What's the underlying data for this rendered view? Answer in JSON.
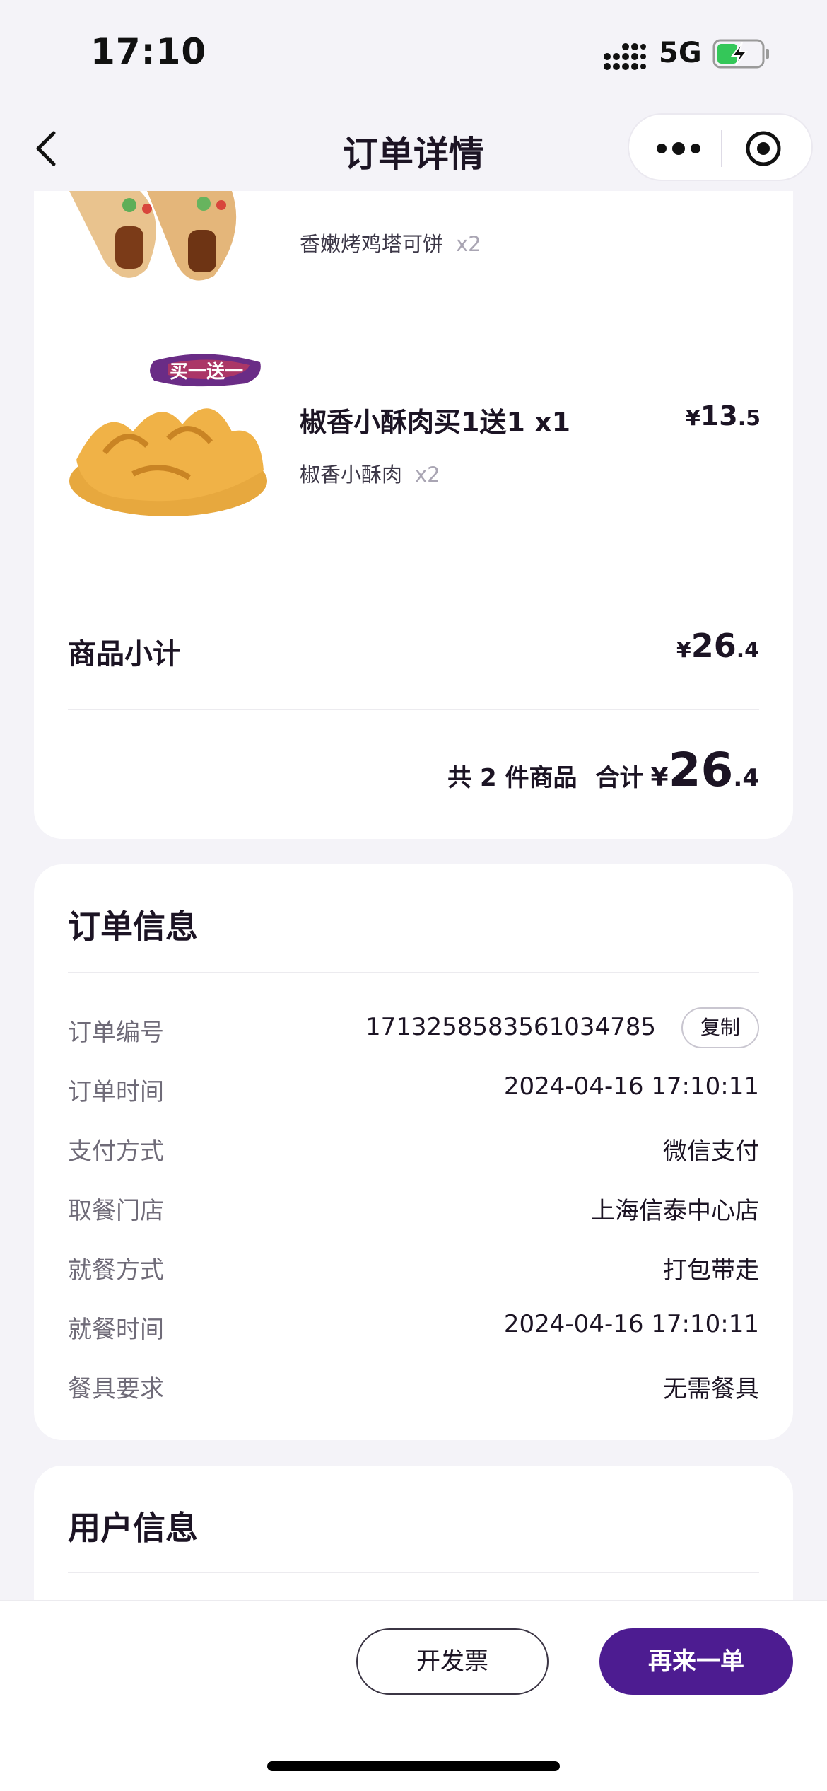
{
  "status_bar": {
    "time": "17:10",
    "network": "5G",
    "icons": [
      "signal-icon",
      "battery-charging-icon"
    ]
  },
  "nav": {
    "title": "订单详情",
    "icons": [
      "back-icon",
      "more-icon",
      "target-icon"
    ]
  },
  "products": [
    {
      "name": "",
      "sub_name": "香嫩烤鸡塔可饼",
      "sub_qty": "x2",
      "image": "chicken-wrap-image"
    },
    {
      "badge": "买一送一",
      "name": "椒香小酥肉买1送1  x1",
      "price_symbol": "¥",
      "price_int": "13",
      "price_dec": ".5",
      "sub_name": "椒香小酥肉",
      "sub_qty": "x2",
      "image": "crispy-pork-image"
    }
  ],
  "summary": {
    "subtotal_label": "商品小计",
    "subtotal_symbol": "¥",
    "subtotal_int": "26",
    "subtotal_dec": ".4",
    "count_text": "共 2 件商品",
    "total_label": "合计",
    "total_symbol": "¥",
    "total_int": "26",
    "total_dec": ".4"
  },
  "order_info": {
    "title": "订单信息",
    "rows": [
      {
        "label": "订单编号",
        "value": "1713258583561034785"
      },
      {
        "label": "订单时间",
        "value": "2024-04-16 17:10:11"
      },
      {
        "label": "支付方式",
        "value": "微信支付"
      },
      {
        "label": "取餐门店",
        "value": "上海信泰中心店"
      },
      {
        "label": "就餐方式",
        "value": "打包带走"
      },
      {
        "label": "就餐时间",
        "value": "2024-04-16 17:10:11"
      },
      {
        "label": "餐具要求",
        "value": "无需餐具"
      }
    ],
    "copy_label": "复制"
  },
  "user_info": {
    "title": "用户信息"
  },
  "bottom_bar": {
    "invoice_label": "开发票",
    "reorder_label": "再来一单"
  },
  "colors": {
    "brand": "#4d1c91",
    "background": "#f4f3f8",
    "text": "#1c1424",
    "muted": "#6f6b78"
  }
}
